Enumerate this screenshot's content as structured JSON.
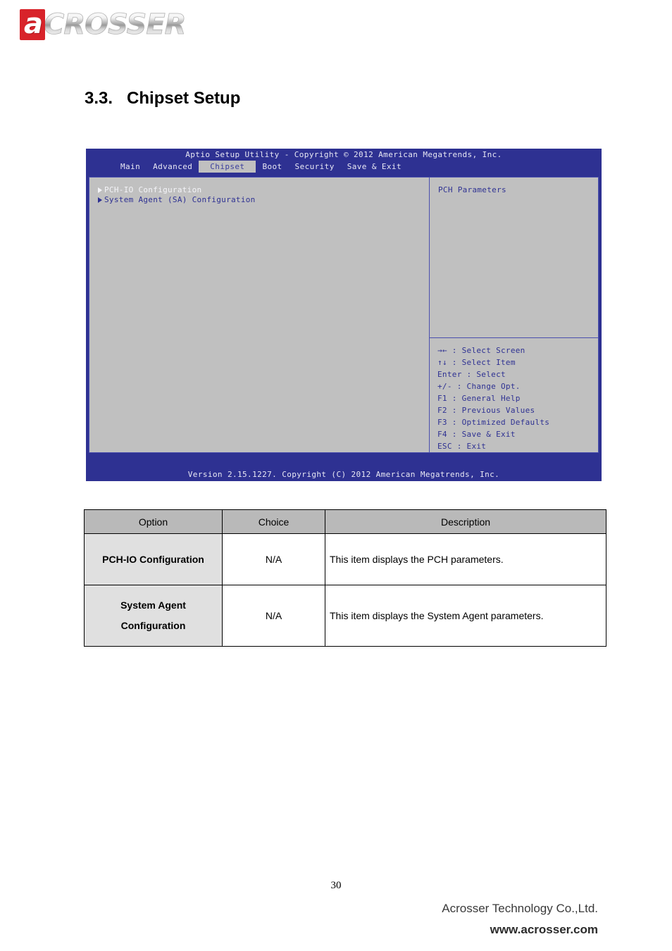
{
  "brand": {
    "logo_first_letter": "a",
    "logo_rest": "CROSSER"
  },
  "heading": {
    "number": "3.3.",
    "title": "Chipset Setup"
  },
  "bios": {
    "title": "Aptio Setup Utility - Copyright © 2012 American Megatrends, Inc.",
    "tabs": [
      {
        "label": "Main",
        "active": false
      },
      {
        "label": "Advanced",
        "active": false
      },
      {
        "label": "Chipset",
        "active": true
      },
      {
        "label": "Boot",
        "active": false
      },
      {
        "label": "Security",
        "active": false
      },
      {
        "label": "Save & Exit",
        "active": false
      }
    ],
    "menu_items": [
      {
        "label": "PCH-IO Configuration",
        "selected": true
      },
      {
        "label": "System Agent (SA) Configuration",
        "selected": false
      }
    ],
    "help_text": "PCH Parameters",
    "legend": [
      "→← : Select Screen",
      "↑↓ : Select Item",
      "Enter : Select",
      "+/- : Change Opt.",
      "F1 : General Help",
      "F2 : Previous Values",
      "F3 : Optimized Defaults",
      "F4 : Save & Exit",
      "ESC : Exit"
    ],
    "footer": "Version 2.15.1227. Copyright (C) 2012 American Megatrends, Inc."
  },
  "table": {
    "headers": [
      "Option",
      "Choice",
      "Description"
    ],
    "rows": [
      {
        "option": "PCH-IO Configuration",
        "choice": "N/A",
        "description": "This item displays the PCH parameters."
      },
      {
        "option": "System Agent Configuration",
        "choice": "N/A",
        "description": "This item displays the System Agent parameters."
      }
    ]
  },
  "page_footer": {
    "page_number": "30",
    "company": "Acrosser Technology Co.,Ltd.",
    "url": "www.acrosser.com"
  },
  "colors": {
    "bios_blue": "#2e3192",
    "bios_gray": "#c0c0c0",
    "brand_red": "#d8232a",
    "table_header_gray": "#b9b9b9",
    "table_option_gray": "#e0e0e0"
  }
}
